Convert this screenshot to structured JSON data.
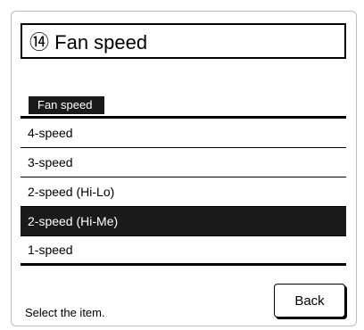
{
  "header": {
    "number": "⑭",
    "title": "Fan speed"
  },
  "section": {
    "label": "Fan speed"
  },
  "options": [
    {
      "label": "4-speed",
      "selected": false
    },
    {
      "label": "3-speed",
      "selected": false
    },
    {
      "label": "2-speed (Hi-Lo)",
      "selected": false
    },
    {
      "label": "2-speed (Hi-Me)",
      "selected": true
    },
    {
      "label": "1-speed",
      "selected": false
    }
  ],
  "footer": {
    "instruction": "Select the item.",
    "back_label": "Back"
  },
  "colors": {
    "selected_bg": "#1a1a1a",
    "selected_text": "#ffffff",
    "text": "#000000"
  }
}
